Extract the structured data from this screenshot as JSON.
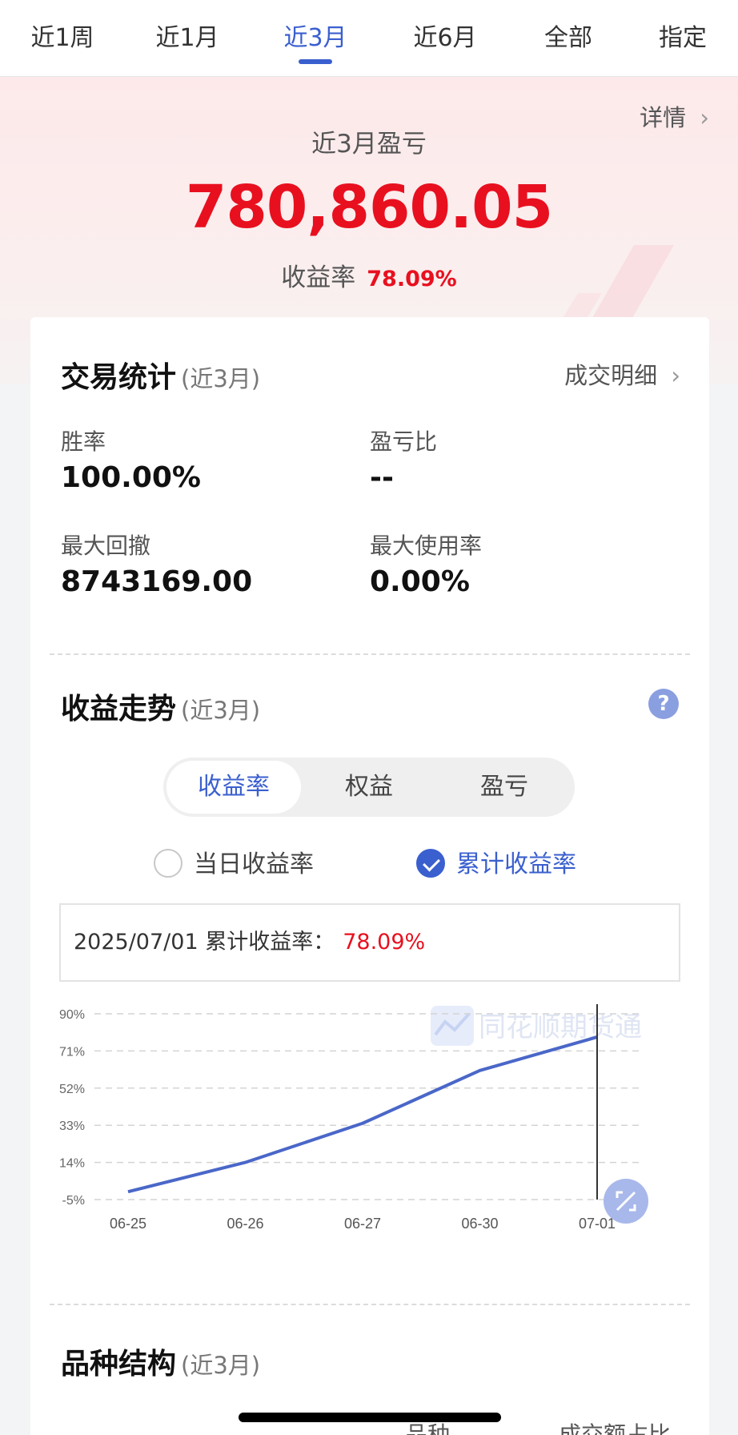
{
  "tabs": [
    {
      "label": "近1周",
      "active": false
    },
    {
      "label": "近1月",
      "active": false
    },
    {
      "label": "近3月",
      "active": true
    },
    {
      "label": "近6月",
      "active": false
    },
    {
      "label": "全部",
      "active": false
    },
    {
      "label": "指定",
      "active": false
    }
  ],
  "summary": {
    "detail_label": "详情",
    "title": "近3月盈亏",
    "value": "780,860.05",
    "rate_label": "收益率",
    "rate_value": "78.09%"
  },
  "stats": {
    "title": "交易统计",
    "sub": "(近3月)",
    "link": "成交明细",
    "items": [
      {
        "label": "胜率",
        "value": "100.00%"
      },
      {
        "label": "盈亏比",
        "value": "--"
      },
      {
        "label": "最大回撤",
        "value": "8743169.00"
      },
      {
        "label": "最大使用率",
        "value": "0.00%"
      }
    ]
  },
  "trend": {
    "title": "收益走势",
    "sub": "(近3月)",
    "help_icon": "question-circle-icon",
    "segments": [
      {
        "label": "收益率",
        "active": true
      },
      {
        "label": "权益",
        "active": false
      },
      {
        "label": "盈亏",
        "active": false
      }
    ],
    "radios": [
      {
        "label": "当日收益率",
        "checked": false
      },
      {
        "label": "累计收益率",
        "checked": true
      }
    ],
    "tip_date": "2025/07/01",
    "tip_label": "累计收益率：",
    "tip_value": "78.09%",
    "watermark": "同花顺期货通"
  },
  "chart_data": {
    "type": "line",
    "x": [
      "06-25",
      "06-26",
      "06-27",
      "06-30",
      "07-01"
    ],
    "series": [
      {
        "values": [
          -1,
          14,
          34,
          61,
          78.09
        ]
      }
    ],
    "y_ticks": [
      "90%",
      "71%",
      "52%",
      "33%",
      "14%",
      "-5%"
    ],
    "ylim": [
      -5,
      90
    ],
    "grid": true,
    "line_color": "#4a67c8",
    "cursor_x": "07-01"
  },
  "structure": {
    "title": "品种结构",
    "sub": "(近3月)",
    "col1": "品种",
    "col2": "成交额占比"
  },
  "colors": {
    "accent": "#3a5fcf",
    "red": "#e8101f"
  }
}
